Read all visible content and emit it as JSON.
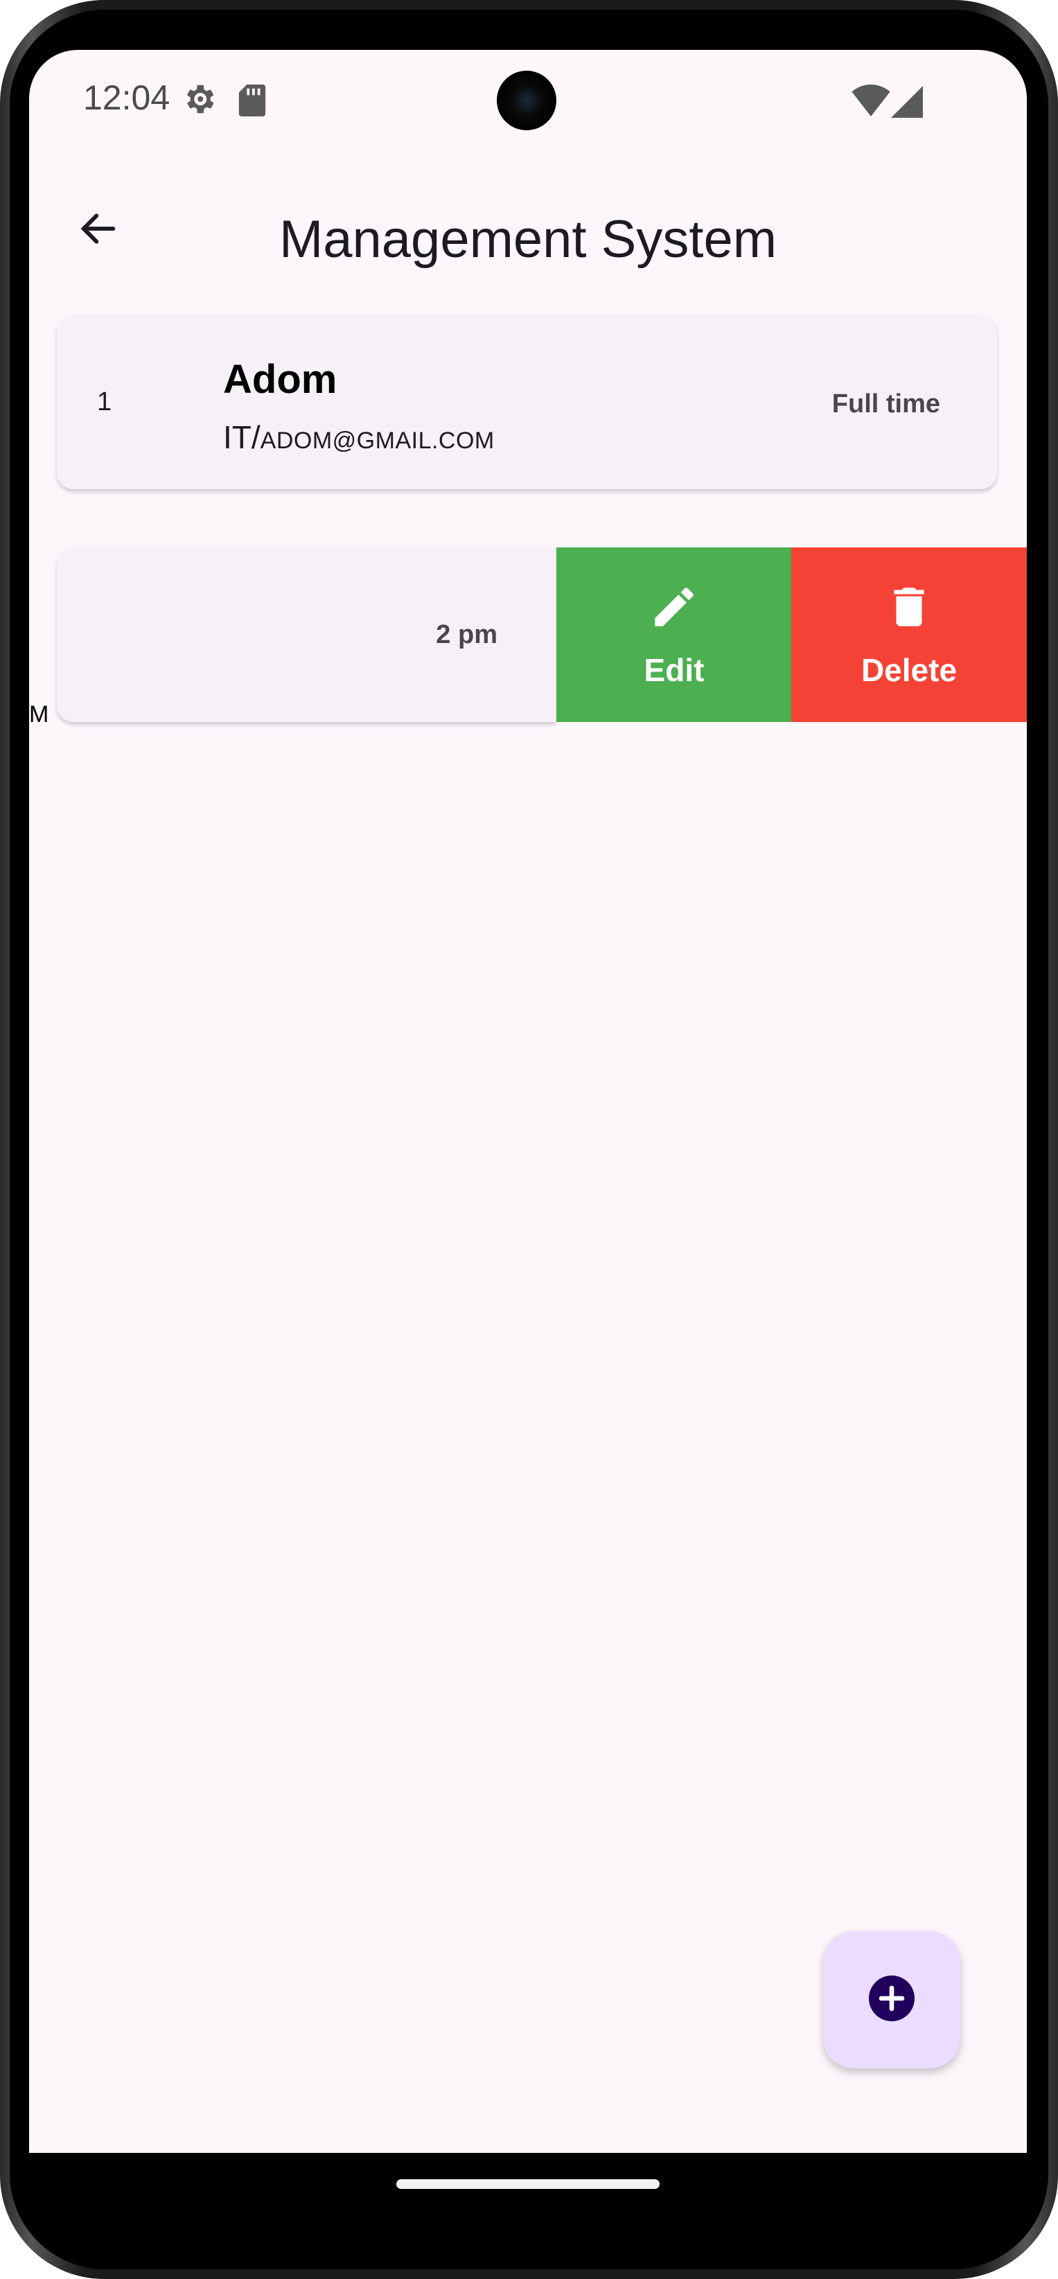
{
  "status_bar": {
    "time": "12:04",
    "icons": [
      "settings-gear-icon",
      "sd-card-icon",
      "wifi-icon",
      "cellular-signal-icon"
    ]
  },
  "app_bar": {
    "title": "Management System",
    "back_icon": "arrow-left-icon"
  },
  "employees": [
    {
      "id": "1",
      "name": "Adom",
      "department": "IT/",
      "email": "ADOM@GMAIL.COM",
      "type": "Full time"
    }
  ],
  "swiped_item": {
    "partial_letter": "M",
    "trailing": "2 pm",
    "actions": {
      "edit_label": "Edit",
      "edit_icon": "pencil-icon",
      "delete_label": "Delete",
      "delete_icon": "trash-icon"
    }
  },
  "fab": {
    "icon": "add-circle-icon"
  },
  "colors": {
    "background": "#fdf7fc",
    "card": "#f5f1f6",
    "edit": "#4caf50",
    "delete": "#f44336",
    "fab": "#eaddff",
    "fab_icon": "#21005d"
  }
}
